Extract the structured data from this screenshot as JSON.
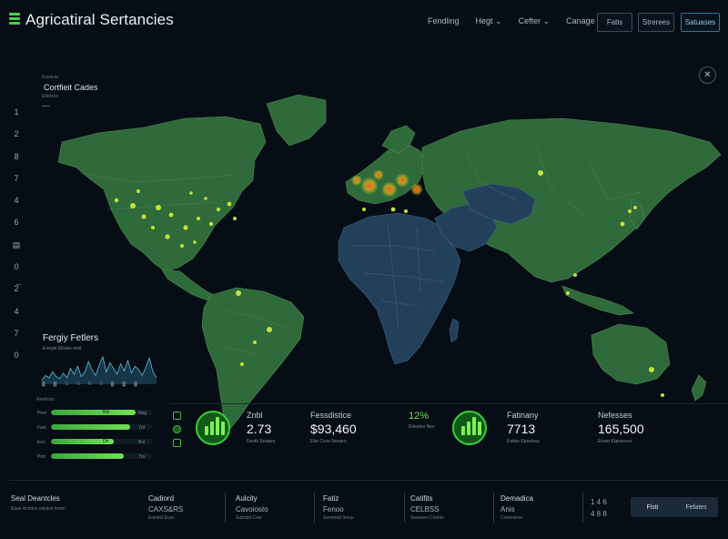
{
  "header": {
    "title": "Agricatiral Sertancies",
    "nav": [
      "Fendling",
      "Hegt",
      "Cefter",
      "Canage"
    ],
    "buttons": [
      "Fatis",
      "Strerees",
      "Satuases"
    ]
  },
  "left_rail": [
    "1",
    "2",
    "8",
    "7",
    "4",
    "6",
    "▤",
    "0",
    "2̅",
    "4",
    "7",
    "0"
  ],
  "overlay_top_left": {
    "tiny_top": "Exeacia",
    "label": "Cortfieit Cades",
    "tiny_bottom": "Ehidecs"
  },
  "facts_panel": {
    "title": "Fergiy Fetlers",
    "subtitle": "Enegle Elliues nmit",
    "sparkline": [
      2,
      6,
      4,
      9,
      5,
      3,
      8,
      4,
      12,
      7,
      14,
      5,
      9,
      18,
      11,
      6,
      15,
      22,
      9,
      17,
      12,
      7,
      16,
      10,
      19,
      8,
      14,
      11,
      6,
      13,
      21,
      9,
      4
    ],
    "axis_ticks": [
      "▓",
      "▓",
      "G",
      "N",
      "N",
      "S",
      "▓",
      "▓",
      "▓"
    ]
  },
  "bars_header": "Reefuuis",
  "bars": [
    {
      "label": "Pesl",
      "value": "Rsl",
      "right": "Reg",
      "fill": 0.84
    },
    {
      "label": "Fael",
      "value": "",
      "right": "Töl",
      "fill": 0.78
    },
    {
      "label": "Ecn",
      "value": "Dh",
      "right": "Bsl",
      "fill": 0.62
    },
    {
      "label": "Pod",
      "value": "",
      "right": "Tro",
      "fill": 0.72
    }
  ],
  "stats": [
    {
      "label": "Znbl",
      "value": "2.73",
      "sub": "Eeotb Eeaaes"
    },
    {
      "label": "Fessdistice",
      "value": "$93,460",
      "sub": "Efer Cess Neuers"
    },
    {
      "label": "12%",
      "value": "",
      "sub": "Etiaetes Nes"
    },
    {
      "label": "Fatinany",
      "value": "7713",
      "sub": "Eetins Epeeless"
    },
    {
      "label": "Nefesses",
      "value": "165,500",
      "sub": "Eriaer Etpoecore"
    }
  ],
  "footer": {
    "columns": [
      {
        "label": "Seal Deantcles",
        "value": "",
        "sub": "Eboe Acmtce ewotsit tewm"
      },
      {
        "label": "Cadiord",
        "value": "CAXS&RS",
        "sub": "Eisrelcl Ecan"
      },
      {
        "label": "Aulcity",
        "value": "Cavoiosto",
        "sub": "Sotmtid Cnsr"
      },
      {
        "label": "Fatiz",
        "value": "Fenoo",
        "sub": "Senmetd Ienus"
      },
      {
        "label": "Catifits",
        "value": "CELBSS",
        "sub": "Seeesen Cnnitin"
      },
      {
        "label": "Demadica",
        "value": "Anis",
        "sub": "Cotemiens"
      }
    ],
    "right": [
      "1 4 6",
      "4 8 8"
    ],
    "buttons": [
      "Fisti",
      "Fefates"
    ]
  }
}
